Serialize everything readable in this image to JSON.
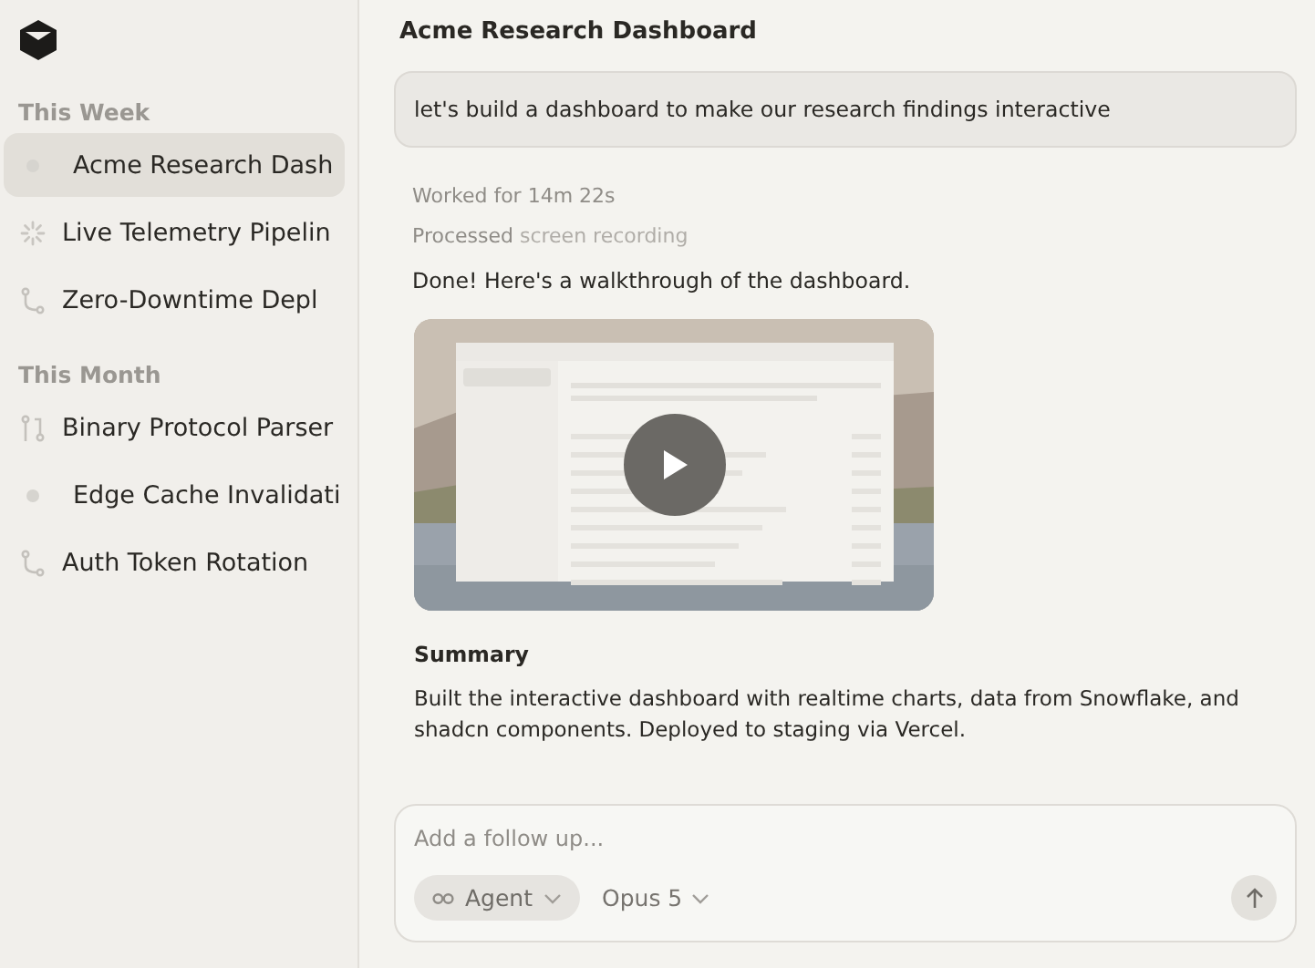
{
  "sidebar": {
    "sections": [
      {
        "heading": "This Week",
        "items": [
          {
            "label": "Acme Research Dash",
            "kind": "dot",
            "selected": true
          },
          {
            "label": "Live Telemetry Pipelin",
            "kind": "spinner",
            "selected": false
          },
          {
            "label": "Zero-Downtime Depl",
            "kind": "branch",
            "selected": false
          }
        ]
      },
      {
        "heading": "This Month",
        "items": [
          {
            "label": "Binary Protocol Parser",
            "kind": "merge",
            "selected": false
          },
          {
            "label": "Edge Cache Invalidati",
            "kind": "dot",
            "selected": false
          },
          {
            "label": "Auth Token Rotation",
            "kind": "branch",
            "selected": false
          }
        ]
      }
    ]
  },
  "chat": {
    "title": "Acme Research Dashboard",
    "prompt": "let's build a dashboard to make our research findings interactive",
    "worked": "Worked for 14m 22s",
    "processed_label": "Processed",
    "processed_item": "screen recording",
    "reply": "Done! Here's a walkthrough of the dashboard.",
    "summary_heading": "Summary",
    "summary": "Built the interactive dashboard with realtime charts, data from Snowflake, and shadcn components. Deployed to staging via Vercel."
  },
  "composer": {
    "placeholder": "Add a follow up...",
    "mode": "Agent",
    "model": "Opus 5"
  }
}
